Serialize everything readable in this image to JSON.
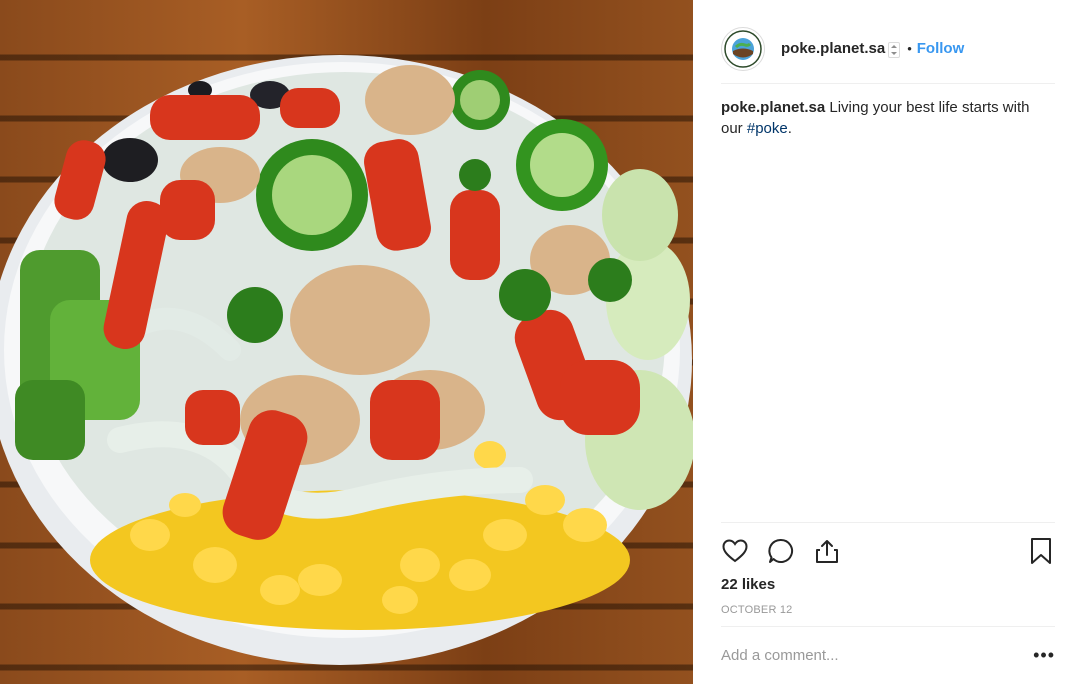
{
  "photo": {
    "alt_icon": "food-photo"
  },
  "post": {
    "username": "poke.planet.sa",
    "separator": "•",
    "follow_label": "Follow",
    "avatar_text": "POKE PLANET"
  },
  "caption": {
    "username": "poke.planet.sa",
    "text_before": " Living your best life starts with our ",
    "hashtag": "#poke",
    "text_after": "."
  },
  "actions": {
    "like_icon": "heart-icon",
    "comment_icon": "comment-icon",
    "share_icon": "share-icon",
    "save_icon": "bookmark-icon"
  },
  "likes": "22 likes",
  "date": "OCTOBER 12",
  "comment": {
    "placeholder": "Add a comment...",
    "more": "•••"
  },
  "colors": {
    "follow": "#3897f0",
    "hashtag": "#003569",
    "divider": "#efefef"
  }
}
